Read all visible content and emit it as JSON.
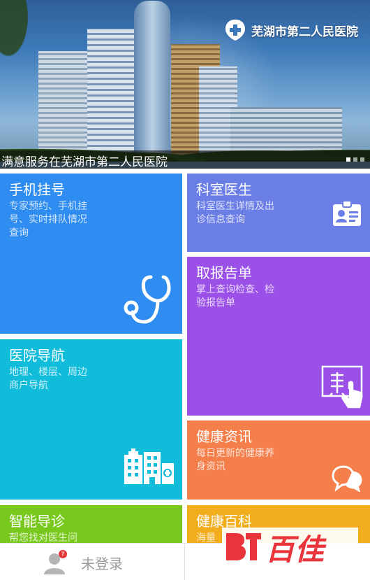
{
  "banner": {
    "logo_text": "芜湖市第二人民医院",
    "caption": "满意服务在芜湖市第二人民医院",
    "slide_count": 3,
    "active_slide": 0
  },
  "tiles": {
    "register": {
      "title": "手机挂号",
      "desc": "专家预约、手机挂号、实时排队情况查询",
      "icon": "stethoscope-icon",
      "color": "#2f8cf0"
    },
    "dept": {
      "title": "科室医生",
      "desc": "科室医生详情及出诊信息查询",
      "icon": "doctor-badge-icon",
      "color": "#6a7ee6"
    },
    "report": {
      "title": "取报告单",
      "desc": "掌上查询检查、检验报告单",
      "icon": "report-hand-icon",
      "color": "#9b50e8"
    },
    "nav": {
      "title": "医院导航",
      "desc": "地理、楼层、周边商户导航",
      "icon": "hospital-building-icon",
      "color": "#10bcd9"
    },
    "news": {
      "title": "健康资讯",
      "desc": "每日更新的健康养身资讯",
      "icon": "chat-bubbles-icon",
      "color": "#f57f4a"
    },
    "triage": {
      "title": "智能导诊",
      "desc": "帮您找对医生问",
      "color": "#79c81d"
    },
    "wiki": {
      "title": "健康百科",
      "desc": "海量",
      "color": "#f2ad1d"
    }
  },
  "bottom_bar": {
    "login_label": "未登录",
    "notification_badge": "?"
  },
  "watermark": {
    "text": "百佳"
  }
}
